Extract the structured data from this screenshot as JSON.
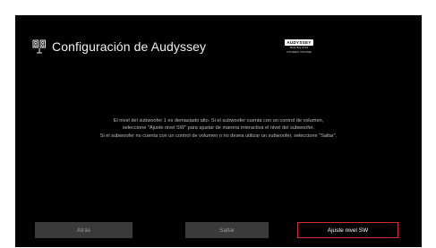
{
  "header": {
    "title": "Configuración de Audyssey",
    "icon": "speaker-icon"
  },
  "logo": {
    "brand": "AUDYSSEY",
    "sub_lines": [
      "MULTEQ XT32",
      "DYNAMIC VOLUME"
    ]
  },
  "message": {
    "lines": [
      "El nivel del subwoofer 1 es demasiado alto. Si el subwoofer cuenta con un control de volumen,",
      "seleccione \"Ajuste nivel SW\" para ajustar de manera interactiva el nivel del subwoofer.",
      "Si el subwoofer no cuenta con un control de volumen o no desea utilizar un subwoofer, seleccione \"Saltar\"."
    ]
  },
  "buttons": {
    "back": "Atrás",
    "skip": "Saltar",
    "adjust": "Ajuste nivel SW"
  },
  "colors": {
    "background": "#000000",
    "focus_border": "#d22b2b",
    "button_inactive": "#3a3a3a"
  }
}
